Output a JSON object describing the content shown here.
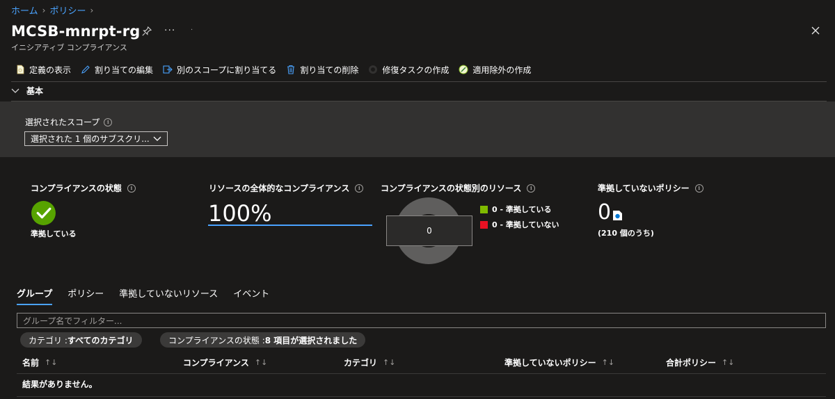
{
  "breadcrumb": {
    "home": "ホーム",
    "policy": "ポリシー",
    "sep": "›"
  },
  "header": {
    "title": "MCSB-mnrpt-rg",
    "subtitle": "イニシアティブ コンプライアンス",
    "more": "···",
    "dot": "·"
  },
  "toolbar": {
    "view_definition": "定義の表示",
    "edit_assignment": "割り当ての編集",
    "assign_other_scope": "別のスコープに割り当てる",
    "delete_assignment": "割り当ての削除",
    "create_remediation": "修復タスクの作成",
    "create_exemption": "適用除外の作成"
  },
  "section": {
    "label": "基本"
  },
  "scope": {
    "label": "選択されたスコープ",
    "value": "選択された 1 個のサブスクリ..."
  },
  "cards": {
    "compliance_state": {
      "label": "コンプライアンスの状態",
      "value": "準拠している"
    },
    "overall_compliance": {
      "label": "リソースの全体的なコンプライアンス",
      "value": "100%"
    },
    "resources_by_state": {
      "label": "コンプライアンスの状態別のリソース",
      "center": "0",
      "legend": [
        {
          "label": "0 - 準拠している",
          "color": "#7fba00"
        },
        {
          "label": "0 - 準拠していない",
          "color": "#e81123"
        }
      ]
    },
    "noncompliant_policies": {
      "label": "準拠していないポリシー",
      "count": "0",
      "of": "(210 個のうち)"
    }
  },
  "tabs": [
    {
      "label": "グループ",
      "active": true
    },
    {
      "label": "ポリシー",
      "active": false
    },
    {
      "label": "準拠していないリソース",
      "active": false
    },
    {
      "label": "イベント",
      "active": false
    }
  ],
  "filter": {
    "placeholder": "グループ名でフィルター..."
  },
  "pills": {
    "category": {
      "key": "カテゴリ : ",
      "value": "すべてのカテゴリ"
    },
    "state": {
      "key": "コンプライアンスの状態 : ",
      "value": "8 項目が選択されました"
    }
  },
  "table": {
    "columns": [
      "名前",
      "コンプライアンス",
      "カテゴリ",
      "準拠していないポリシー",
      "合計ポリシー"
    ],
    "sort_glyph": "↑↓",
    "empty": "結果がありません。"
  },
  "colors": {
    "accent": "#4aa3ff",
    "success": "#57a300",
    "background": "#1b1a19",
    "panel": "#323130"
  }
}
